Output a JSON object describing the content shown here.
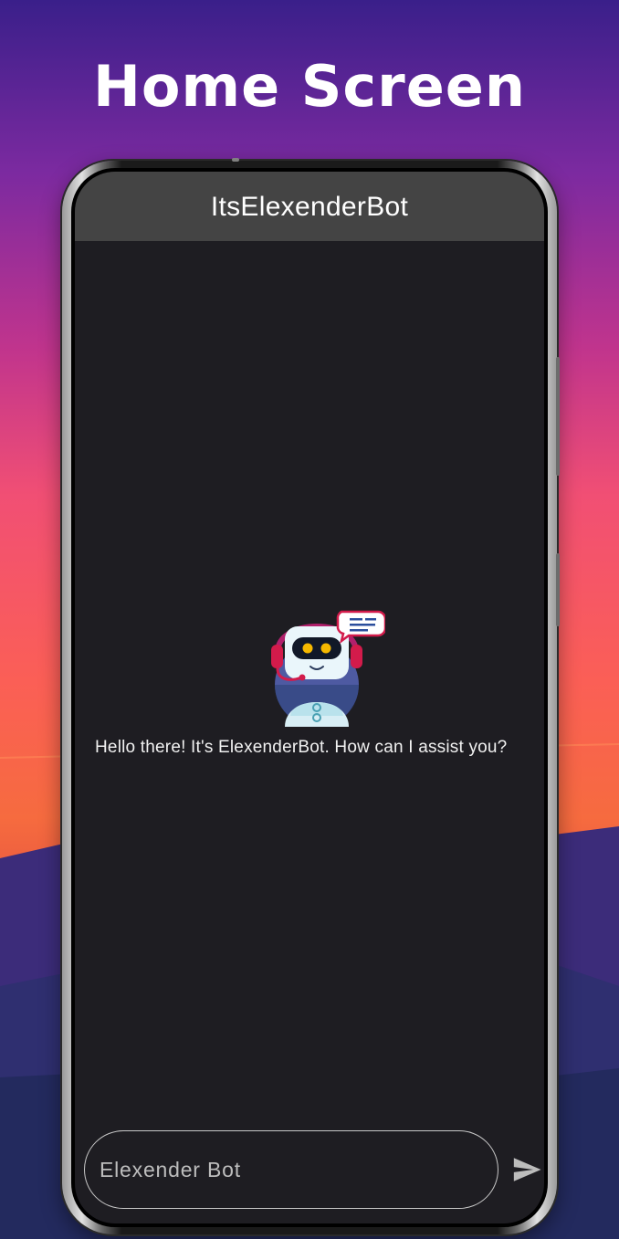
{
  "page": {
    "heading": "Home Screen"
  },
  "app": {
    "title": "ItsElexenderBot",
    "welcome_message": "Hello there! It's ElexenderBot. How can I assist you?",
    "bot_avatar_icon": "robot-with-headset-icon"
  },
  "composer": {
    "input_value": "",
    "input_placeholder": "Elexender Bot",
    "send_icon": "send-icon"
  },
  "colors": {
    "app_bar": "#444444",
    "screen_background": "#1e1d22",
    "text_primary": "#ffffff",
    "avatar_accent": "#d31b4b",
    "avatar_headset": "#b1206c"
  }
}
